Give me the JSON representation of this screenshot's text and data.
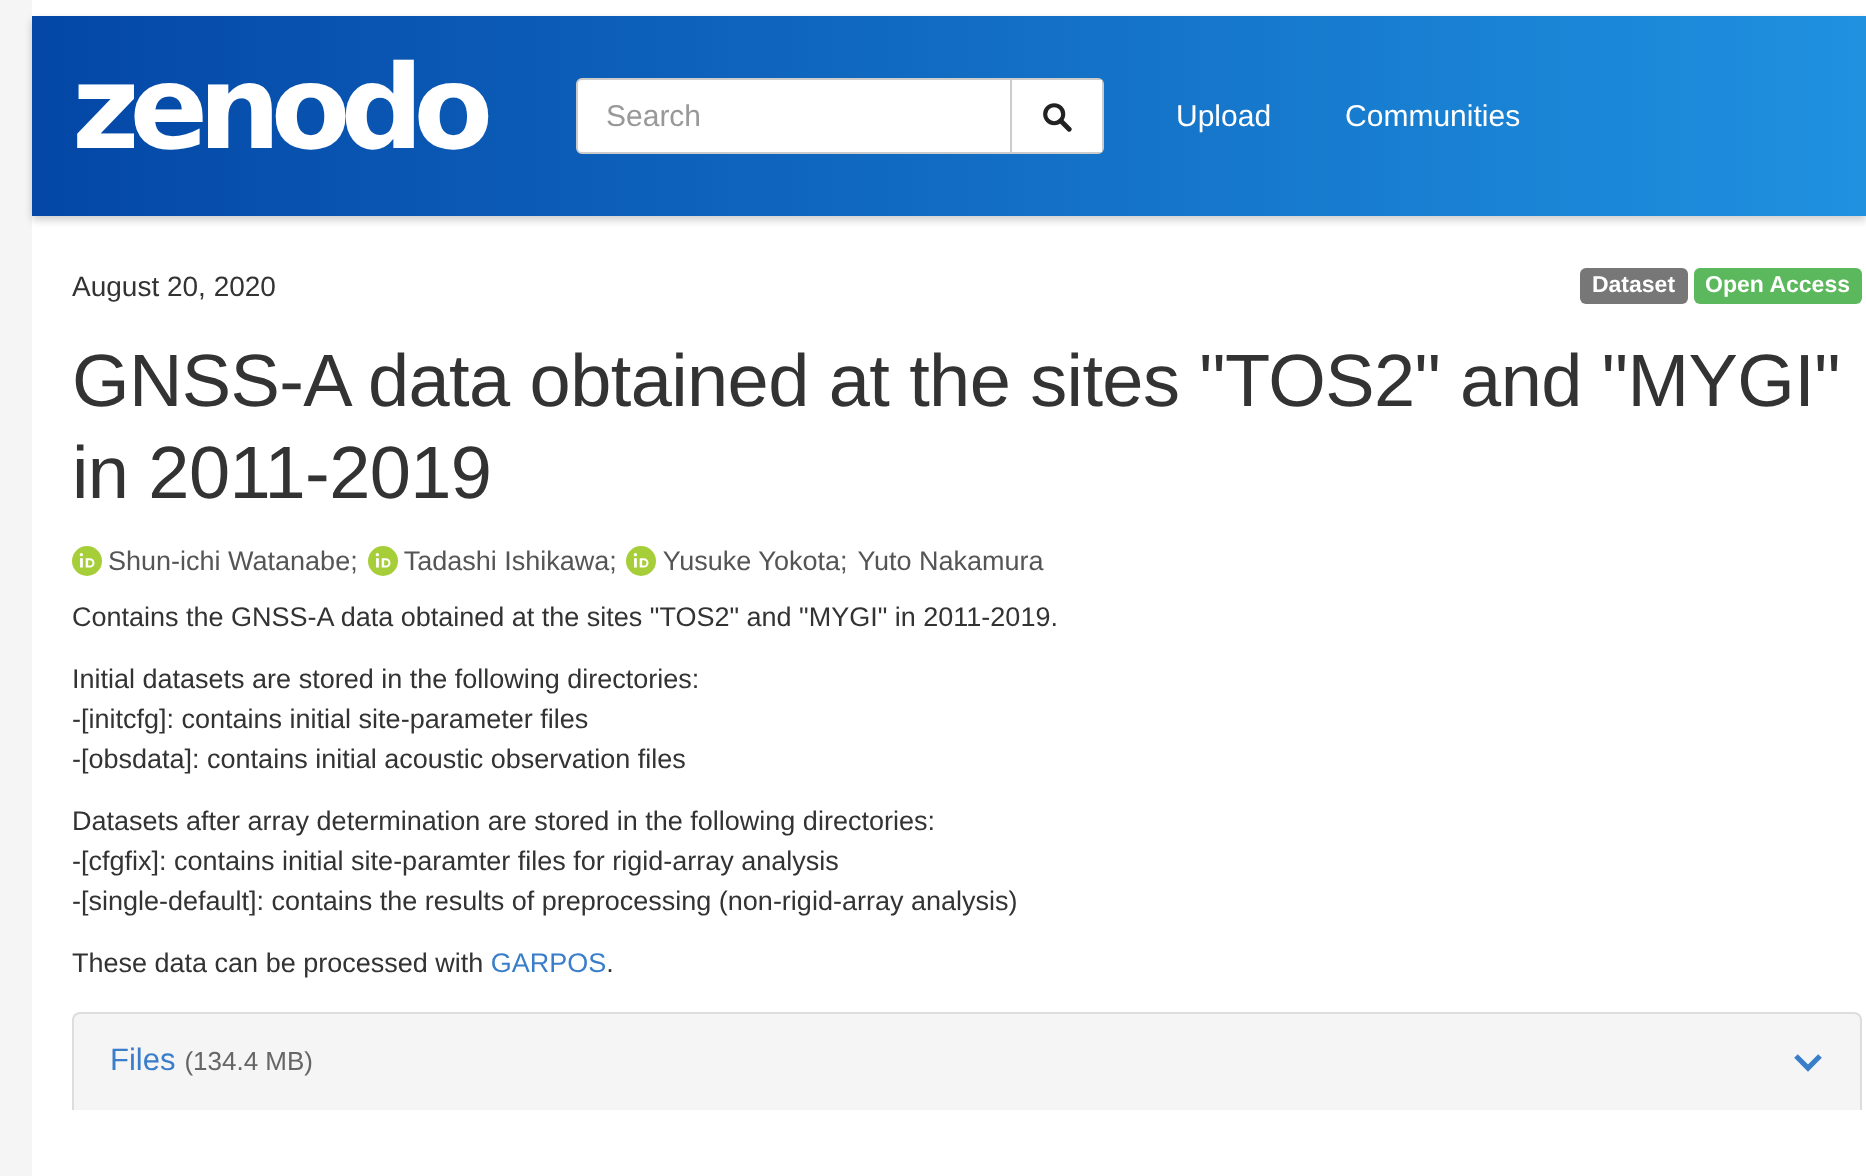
{
  "header": {
    "logo": "zenodo",
    "search": {
      "placeholder": "Search"
    },
    "nav": [
      "Upload",
      "Communities"
    ]
  },
  "record": {
    "date": "August 20, 2020",
    "badges": [
      {
        "label": "Dataset",
        "color": "#777777"
      },
      {
        "label": "Open Access",
        "color": "#5cb85c"
      }
    ],
    "title": "GNSS-A data obtained at the sites \"TOS2\" and \"MYGI\" in 2011-2019",
    "authors": [
      {
        "name": "Shun-ichi Watanabe;",
        "orcid": true
      },
      {
        "name": "Tadashi Ishikawa;",
        "orcid": true
      },
      {
        "name": "Yusuke Yokota;",
        "orcid": true
      },
      {
        "name": "Yuto Nakamura",
        "orcid": false
      }
    ],
    "description": [
      {
        "lines": [
          "Contains the GNSS-A data obtained at the sites \"TOS2\" and \"MYGI\" in 2011-2019."
        ]
      },
      {
        "lines": [
          "Initial datasets are stored in the following directories:",
          "-[initcfg]: contains initial site-parameter files",
          "-[obsdata]: contains initial acoustic observation files"
        ]
      },
      {
        "lines": [
          "Datasets after array determination are stored in the following directories:",
          "-[cfgfix]: contains initial site-paramter files for rigid-array analysis",
          "-[single-default]: contains the results of preprocessing (non-rigid-array analysis)"
        ]
      },
      {
        "text": "These data can be processed with ",
        "link": "GARPOS",
        "after": "."
      }
    ],
    "files": {
      "label": "Files",
      "size": "(134.4 MB)",
      "expanded": false
    }
  }
}
